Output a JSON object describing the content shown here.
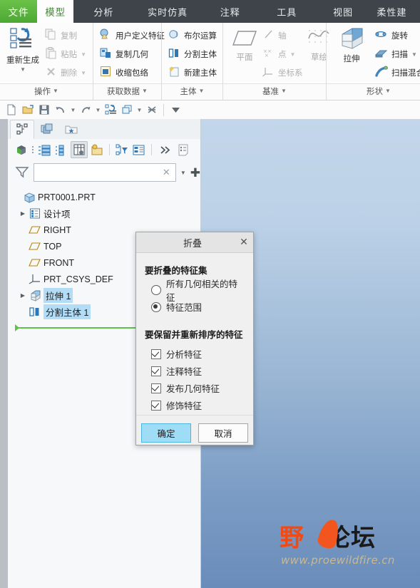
{
  "tabs": [
    {
      "label": "文件",
      "key": "file"
    },
    {
      "label": "模型",
      "key": "model"
    },
    {
      "label": "分析",
      "key": "analysis"
    },
    {
      "label": "实时仿真",
      "key": "sim"
    },
    {
      "label": "注释",
      "key": "annotation"
    },
    {
      "label": "工具",
      "key": "tools"
    },
    {
      "label": "视图",
      "key": "view"
    },
    {
      "label": "柔性建",
      "key": "flex"
    }
  ],
  "ribbon": {
    "groups": [
      {
        "name": "操作",
        "big": {
          "label": "重新生成",
          "icon": "regenerate-icon"
        },
        "items": [
          {
            "label": "复制",
            "icon": "copy-icon",
            "disabled": true,
            "caret": false
          },
          {
            "label": "粘贴",
            "icon": "paste-icon",
            "disabled": true,
            "caret": true
          },
          {
            "label": "删除",
            "icon": "delete-icon",
            "disabled": true,
            "caret": true
          }
        ]
      },
      {
        "name": "获取数据",
        "items": [
          {
            "label": "用户定义特征",
            "icon": "udf-icon",
            "disabled": false,
            "caret": false
          },
          {
            "label": "复制几何",
            "icon": "copy-geometry-icon",
            "disabled": false,
            "caret": false
          },
          {
            "label": "收缩包络",
            "icon": "shrinkwrap-icon",
            "disabled": false,
            "caret": false
          }
        ]
      },
      {
        "name": "主体",
        "items": [
          {
            "label": "布尔运算",
            "icon": "boolean-icon",
            "disabled": false,
            "caret": false
          },
          {
            "label": "分割主体",
            "icon": "split-body-icon",
            "disabled": false,
            "caret": false
          },
          {
            "label": "新建主体",
            "icon": "new-body-icon",
            "disabled": false,
            "caret": false
          }
        ]
      },
      {
        "name": "基准",
        "big": {
          "label": "平面",
          "icon": "datum-plane-icon"
        },
        "big2": {
          "label": "草绘",
          "icon": "sketch-icon"
        },
        "items": [
          {
            "label": "轴",
            "icon": "datum-axis-icon",
            "disabled": true,
            "caret": false
          },
          {
            "label": "点",
            "icon": "datum-point-icon",
            "disabled": true,
            "caret": true
          },
          {
            "label": "坐标系",
            "icon": "coordinate-system-icon",
            "disabled": true,
            "caret": false
          }
        ]
      },
      {
        "name": "形状",
        "big": {
          "label": "拉伸",
          "icon": "extrude-icon"
        },
        "items": [
          {
            "label": "旋转",
            "icon": "revolve-icon",
            "disabled": false,
            "caret": false
          },
          {
            "label": "扫描",
            "icon": "sweep-icon",
            "disabled": false,
            "caret": true
          },
          {
            "label": "扫描混合",
            "icon": "swept-blend-icon",
            "disabled": false,
            "caret": false
          }
        ]
      }
    ]
  },
  "quick_access": {
    "buttons": [
      {
        "icon": "new-file-icon"
      },
      {
        "icon": "open-folder-icon"
      },
      {
        "icon": "save-icon"
      },
      {
        "icon": "undo-icon",
        "caret": true
      },
      {
        "icon": "redo-icon",
        "caret": true
      },
      {
        "icon": "regenerate-model-icon"
      },
      {
        "icon": "window-icon",
        "caret": true
      },
      {
        "icon": "close-window-icon"
      }
    ],
    "overflow_icon": "overflow-caret-icon"
  },
  "navigator": {
    "tabs": [
      {
        "icon": "model-tree-icon",
        "selected": true
      },
      {
        "icon": "layers-icon",
        "selected": false
      },
      {
        "icon": "favorites-folder-icon",
        "selected": false
      }
    ],
    "tools": [
      {
        "icon": "model-cube-icon"
      },
      {
        "icon": "tree-list-icon"
      },
      {
        "icon": "tree-columns-icon"
      },
      {
        "icon": "tree-table-icon",
        "active": true
      },
      {
        "icon": "settings-folder-icon"
      },
      {
        "icon": "tree-filter-icon"
      },
      {
        "icon": "tree-columns2-icon"
      },
      {
        "icon": "more-chevrons-icon"
      },
      {
        "icon": "notes-icon"
      }
    ],
    "filter": {
      "icon": "funnel-icon",
      "value": "",
      "placeholder": "",
      "clear_icon": "clear-x-icon",
      "caret_icon": "chevron-down-icon",
      "add_icon": "plus-icon"
    }
  },
  "tree": {
    "items": [
      {
        "label": "PRT0001.PRT",
        "icon": "part-icon",
        "indent": 0,
        "expander": "",
        "selected": false
      },
      {
        "label": "设计项",
        "icon": "design-items-icon",
        "indent": 1,
        "expander": "▶",
        "selected": false
      },
      {
        "label": "RIGHT",
        "icon": "datum-plane-icon",
        "indent": 1,
        "expander": "",
        "selected": false
      },
      {
        "label": "TOP",
        "icon": "datum-plane-icon",
        "indent": 1,
        "expander": "",
        "selected": false
      },
      {
        "label": "FRONT",
        "icon": "datum-plane-icon",
        "indent": 1,
        "expander": "",
        "selected": false
      },
      {
        "label": "PRT_CSYS_DEF",
        "icon": "coordinate-system-icon",
        "indent": 1,
        "expander": "",
        "selected": false
      },
      {
        "label": "拉伸 1",
        "icon": "extrude-feature-icon",
        "indent": 1,
        "expander": "▶",
        "selected": true
      },
      {
        "label": "分割主体 1",
        "icon": "split-body-icon",
        "indent": 1,
        "expander": "",
        "selected": true
      }
    ],
    "insert_indicator": "insert-here-marker"
  },
  "dialog": {
    "title": "折叠",
    "close_icon": "close-icon",
    "section1": "要折叠的特征集",
    "radios": [
      {
        "label": "所有几何相关的特征",
        "checked": false
      },
      {
        "label": "特征范围",
        "checked": true
      }
    ],
    "section2": "要保留并重新排序的特征",
    "checkboxes": [
      {
        "label": "分析特征",
        "checked": true
      },
      {
        "label": "注释特征",
        "checked": true
      },
      {
        "label": "发布几何特征",
        "checked": true
      },
      {
        "label": "修饰特征",
        "checked": true
      }
    ],
    "ok_label": "确定",
    "cancel_label": "取消"
  },
  "watermark": {
    "text_part1": "野",
    "text_part2": "论坛",
    "url": "www.proewildfire.cn"
  },
  "colors": {
    "file_tab_green": "#5cb85c",
    "active_tab_text": "#3f8d2f",
    "tab_bar_dark": "#3e4449",
    "tree_selection": "#b3ddf7",
    "insert_line_green": "#5fc24a",
    "primary_button": "#9fdcf6",
    "graphics_top": "#c3d6ea",
    "graphics_bottom": "#6a8cba",
    "watermark_orange": "#f04b16"
  }
}
